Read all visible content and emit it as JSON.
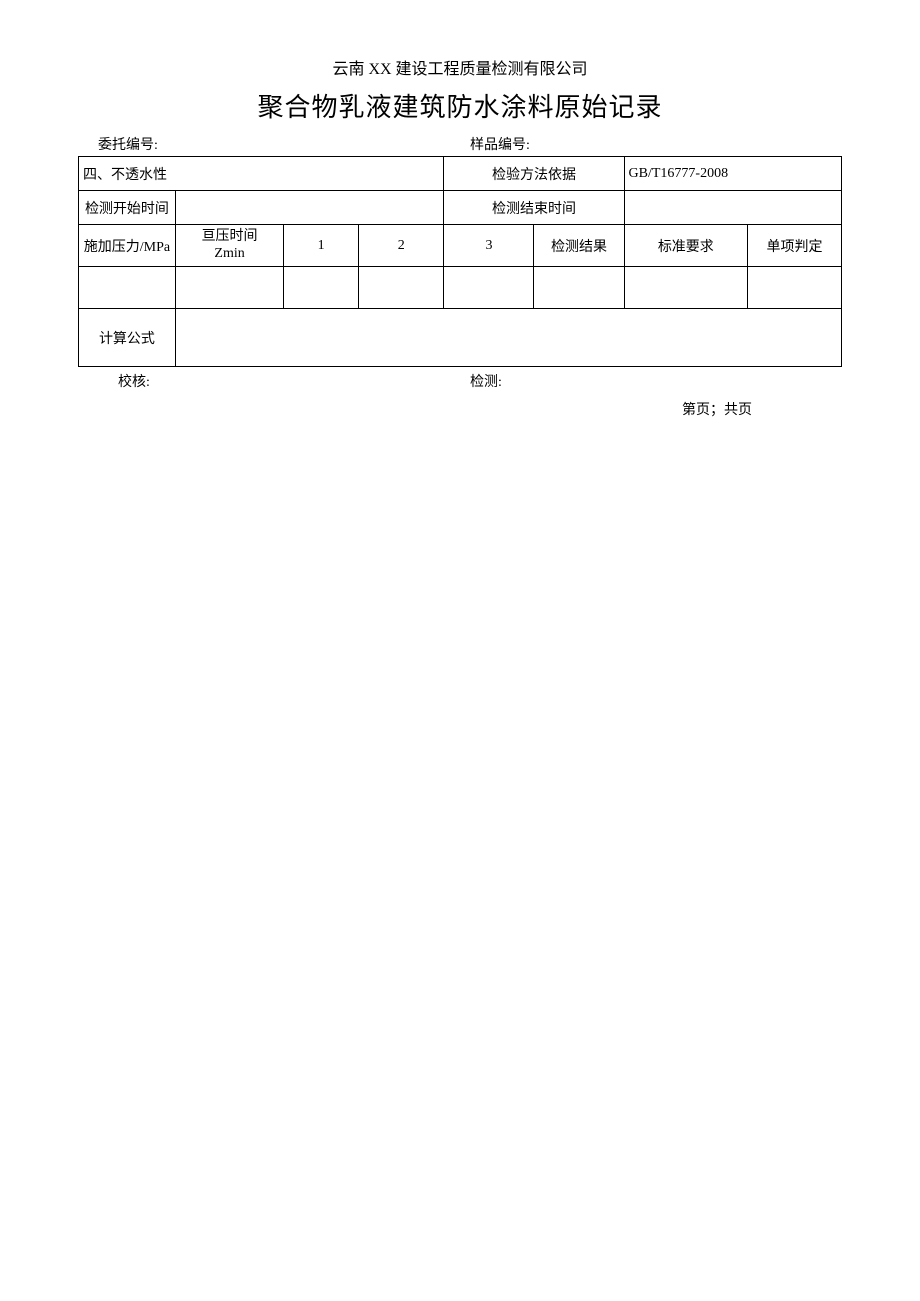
{
  "header": {
    "company": "云南 XX 建设工程质量检测有限公司",
    "title": "聚合物乳液建筑防水涂料原始记录"
  },
  "meta": {
    "entrust_no_label": "委托编号:",
    "sample_no_label": "样品编号:"
  },
  "table": {
    "section_label": "四、不透水性",
    "method_basis_label": "检验方法依据",
    "method_basis_value": "GB/T16777-2008",
    "start_time_label": "检测开始时间",
    "end_time_label": "检测结束时间",
    "pressure_label": "施加压力/MPa",
    "hold_time_label_line1": "亘压时间",
    "hold_time_label_line2": "Zmin",
    "col_1": "1",
    "col_2": "2",
    "col_3": "3",
    "result_label": "检测结果",
    "standard_req_label": "标准要求",
    "single_judge_label": "单项判定",
    "formula_label": "计算公式"
  },
  "footer": {
    "checker_label": "校核:",
    "tester_label": "检测:",
    "page_label": "第页；共页"
  }
}
